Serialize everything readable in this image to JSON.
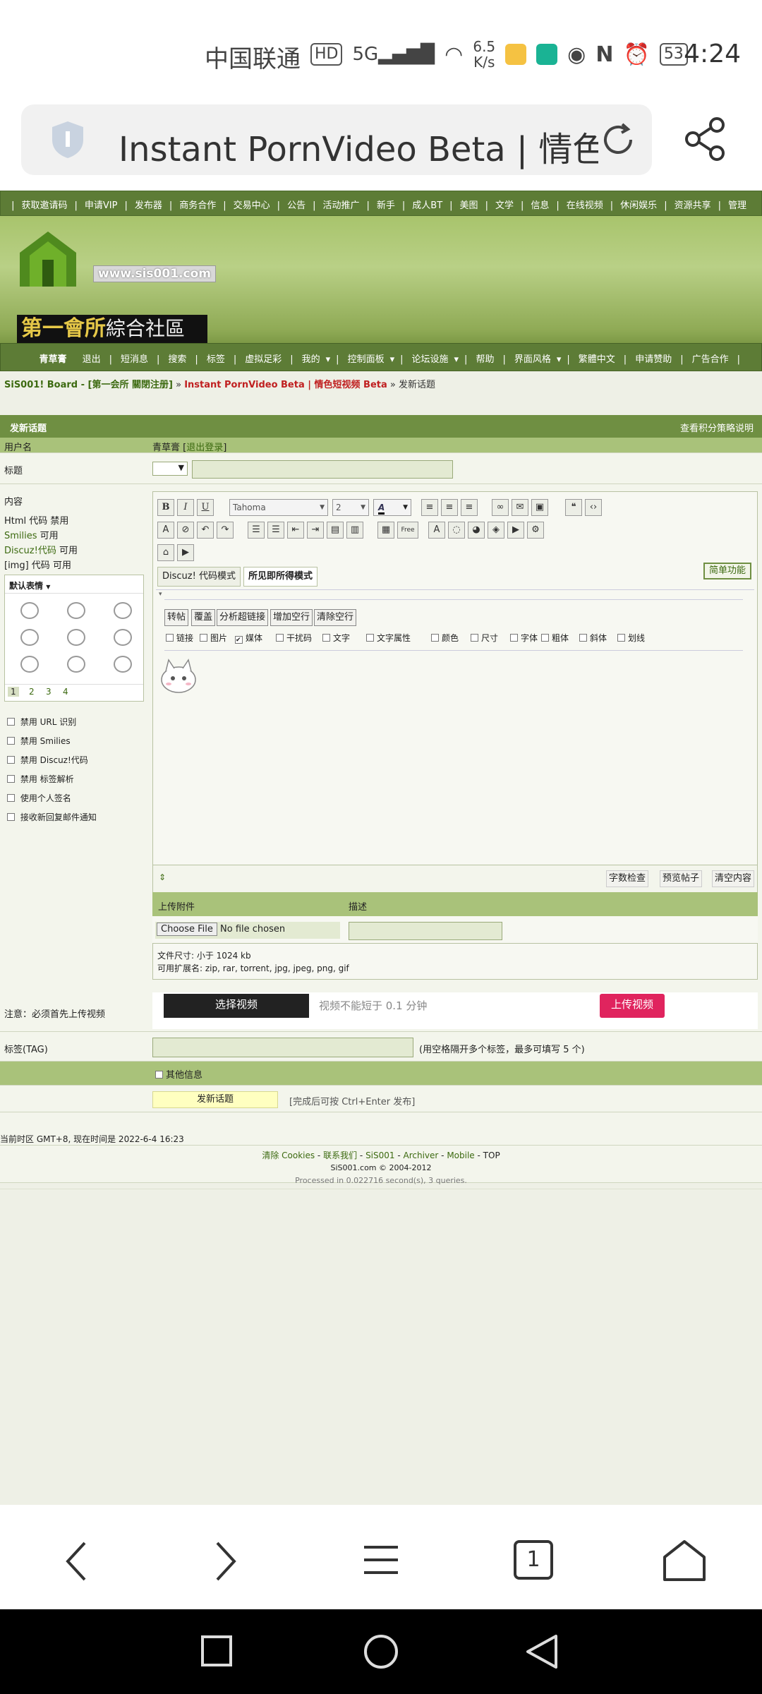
{
  "status_bar": {
    "carrier": "中国联通",
    "speed_top": "6.5",
    "speed_bottom": "K/s",
    "battery": "53",
    "time": "4:24"
  },
  "browser": {
    "url_text": "Instant PornVideo Beta | 情色",
    "tab_count": "1"
  },
  "top_links": [
    "获取邀请码",
    "申请VIP",
    "发布器",
    "商务合作",
    "交易中心",
    "公告",
    "活动推广",
    "新手",
    "成人BT",
    "美图",
    "文学",
    "信息",
    "在线视频",
    "休闲娱乐",
    "资源共享",
    "管理"
  ],
  "logo": {
    "url": "www.sis001.com",
    "name": "第一會所",
    "sub": "綜合社區"
  },
  "main_nav": {
    "user": "青草膏",
    "items": [
      "退出",
      "短消息",
      "搜索",
      "标签",
      "虚拟足彩",
      "我的",
      "控制面板",
      "论坛设施",
      "帮助",
      "界面风格",
      "繁體中文",
      "申请赞助",
      "广告合作"
    ]
  },
  "breadcrumb": {
    "board": "SiS001! Board - [第一会所 關閉注册]",
    "sep": "»",
    "forum": "Instant PornVideo Beta | 情色短视频 Beta",
    "page": "发新话题"
  },
  "form": {
    "header": "发新话题",
    "header_right": "查看积分策略说明",
    "username_label": "用户名",
    "username": "青草膏",
    "logout": "退出登录",
    "title_label": "标题",
    "content_label": "内容",
    "html_code": "Html 代码",
    "html_state": "禁用",
    "smilies": "Smilies",
    "smilies_state": "可用",
    "discuz_code": "Discuz!代码",
    "discuz_state": "可用",
    "img_code": "[img] 代码",
    "img_state": "可用",
    "default_smilies": "默认表情",
    "smiley_pages": [
      "1",
      "2",
      "3",
      "4"
    ],
    "options": [
      "禁用 URL 识别",
      "禁用 Smilies",
      "禁用 Discuz!代码",
      "禁用 标签解析",
      "使用个人签名",
      "接收新回复邮件通知"
    ]
  },
  "editor": {
    "font": "Tahoma",
    "size": "2",
    "mode_code": "Discuz! 代码模式",
    "mode_wysiwyg": "所见即所得模式",
    "simple": "简单功能",
    "action_buttons": [
      "转帖",
      "覆盖",
      "分析超链接",
      "增加空行",
      "清除空行"
    ],
    "filters": [
      "链接",
      "图片",
      "媒体",
      "干扰码",
      "文字",
      "文字属性",
      "颜色",
      "尺寸",
      "字体",
      "粗体",
      "斜体",
      "划线"
    ],
    "footer_buttons": [
      "字数检查",
      "预览帖子",
      "清空内容"
    ]
  },
  "attach": {
    "upload_label": "上传附件",
    "desc_label": "描述",
    "choose_file": "Choose File",
    "no_file": "No file chosen",
    "size_note": "文件尺寸: 小于 1024 kb",
    "ext_note": "可用扩展名: zip, rar, torrent, jpg, jpeg, png, gif"
  },
  "video": {
    "notice": "注意：必须首先上传视频",
    "select": "选择视频",
    "hint": "视频不能短于 0.1 分钟",
    "upload": "上传视频"
  },
  "tags": {
    "label": "标签(TAG)",
    "hint": "(用空格隔开多个标签，最多可填写 5 个)"
  },
  "other_info": "其他信息",
  "submit": {
    "label": "发新话题",
    "hint": "[完成后可按 Ctrl+Enter 发布]"
  },
  "footer": {
    "timezone": "当前时区 GMT+8, 现在时间是 2022-6-4 16:23",
    "links": [
      "清除 Cookies",
      "联系我们",
      "SiS001",
      "Archiver",
      "Mobile",
      "TOP"
    ],
    "copyright": "SiS001.com © 2004-2012",
    "processed": "Processed in 0.022716 second(s), 3 queries."
  },
  "colors": {
    "nav_green": "#5d7c36",
    "row_green": "#a9c27a",
    "upload_red": "#e0245e",
    "page_bg": "#eef0e6"
  }
}
